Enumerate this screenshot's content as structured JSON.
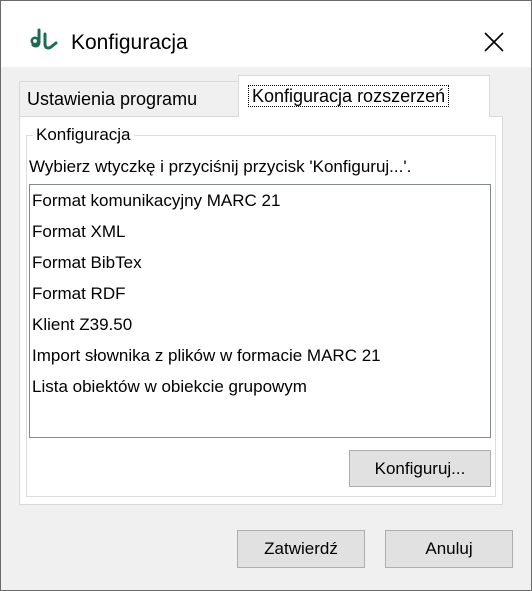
{
  "window": {
    "title": "Konfiguracja",
    "close_glyph": "✕"
  },
  "tabs": [
    {
      "label": "Ustawienia programu",
      "active": false
    },
    {
      "label": "Konfiguracja rozszerzeń",
      "active": true
    }
  ],
  "group": {
    "legend": "Konfiguracja",
    "instruction": "Wybierz wtyczkę i przyciśnij przycisk 'Konfiguruj...'.",
    "plugins": [
      "Format komunikacyjny MARC 21",
      "Format XML",
      "Format BibTex",
      "Format RDF",
      "Klient Z39.50",
      "Import słownika z plików w formacie MARC 21",
      "Lista obiektów w obiekcie grupowym"
    ],
    "configure_label": "Konfiguruj..."
  },
  "footer": {
    "ok_label": "Zatwierdź",
    "cancel_label": "Anuluj"
  },
  "icons": {
    "app": "app-logo-icon",
    "close": "close-icon"
  },
  "colors": {
    "brand_icon": "#1f6b52",
    "window_bg": "#f0f0f0",
    "panel_bg": "#ffffff",
    "button_bg": "#e1e1e1"
  }
}
